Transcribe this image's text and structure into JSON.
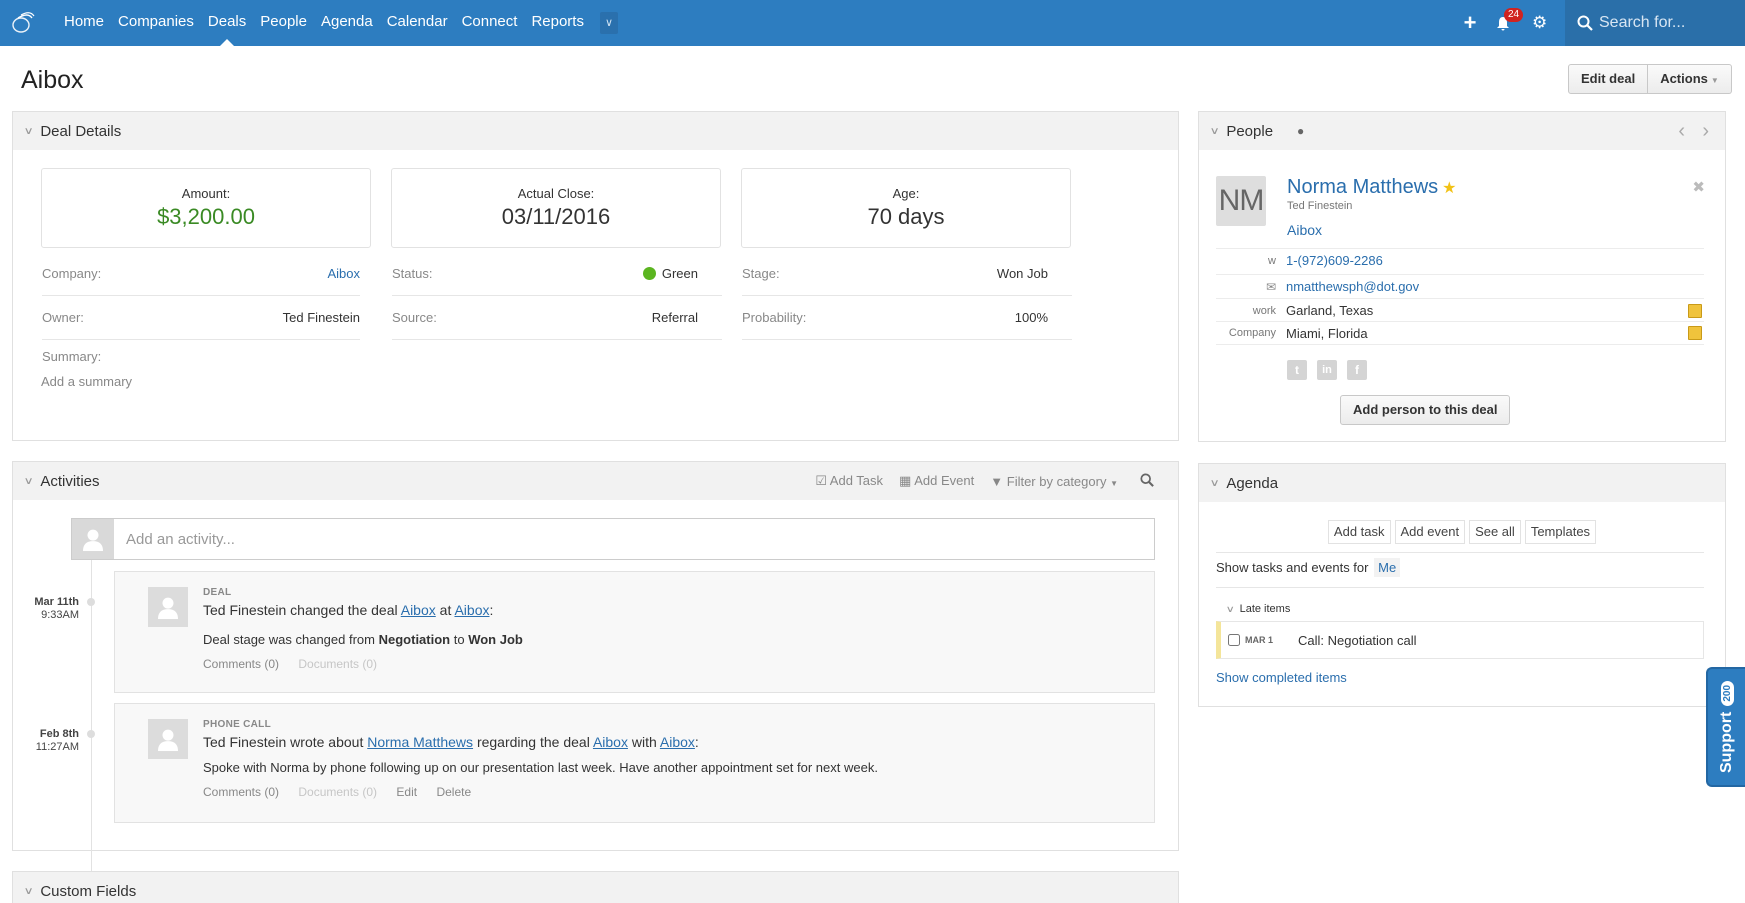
{
  "nav": {
    "items": [
      {
        "label": "Home",
        "active": false
      },
      {
        "label": "Companies",
        "active": false
      },
      {
        "label": "Deals",
        "active": true
      },
      {
        "label": "People",
        "active": false
      },
      {
        "label": "Agenda",
        "active": false
      },
      {
        "label": "Calendar",
        "active": false
      },
      {
        "label": "Connect",
        "active": false
      },
      {
        "label": "Reports",
        "active": false
      }
    ],
    "more_icon": "chevron-down-icon",
    "notifications_count": "24",
    "search_placeholder": "Search for..."
  },
  "page": {
    "title": "Aibox",
    "edit_label": "Edit deal",
    "actions_label": "Actions"
  },
  "deal_details": {
    "header": "Deal Details",
    "stats": [
      {
        "label": "Amount:",
        "value": "$3,200.00"
      },
      {
        "label": "Actual Close:",
        "value": "03/11/2016"
      },
      {
        "label": "Age:",
        "value": "70 days"
      }
    ],
    "fields": {
      "company": {
        "label": "Company:",
        "value": "Aibox"
      },
      "owner": {
        "label": "Owner:",
        "value": "Ted Finestein"
      },
      "status": {
        "label": "Status:",
        "value": "Green",
        "color": "#5bb520"
      },
      "source": {
        "label": "Source:",
        "value": "Referral"
      },
      "stage": {
        "label": "Stage:",
        "value": "Won Job"
      },
      "probability": {
        "label": "Probability:",
        "value": "100%"
      }
    },
    "summary_label": "Summary:",
    "summary_placeholder": "Add a summary"
  },
  "activities": {
    "header": "Activities",
    "add_task": "Add Task",
    "add_event": "Add Event",
    "filter": "Filter by category",
    "input_placeholder": "Add an activity...",
    "items": [
      {
        "date": "Mar 11th",
        "time": "9:33AM",
        "type": "DEAL",
        "author": "Ted Finestein",
        "verb": "changed the deal",
        "link1": "Aibox",
        "joiner": "at",
        "link2": "Aibox",
        "text_prefix": "Deal stage was changed from",
        "from": "Negotiation",
        "to_word": "to",
        "to": "Won Job",
        "comments": "Comments (0)",
        "documents": "Documents (0)"
      },
      {
        "date": "Feb 8th",
        "time": "11:27AM",
        "type": "PHONE CALL",
        "author": "Ted Finestein",
        "verb": "wrote about",
        "person": "Norma Matthews",
        "regarding": "regarding the deal",
        "link1": "Aibox",
        "joiner": "with",
        "link2": "Aibox",
        "text": "Spoke with Norma by phone following up on our presentation last week. Have another appointment set for next week.",
        "comments": "Comments (0)",
        "documents": "Documents (0)",
        "edit": "Edit",
        "delete": "Delete"
      }
    ]
  },
  "custom_fields": {
    "header": "Custom Fields"
  },
  "people": {
    "header": "People",
    "initials": "NM",
    "name": "Norma Matthews",
    "owner": "Ted Finestein",
    "company": "Aibox",
    "phone_label": "w",
    "phone": "1-(972)609-2286",
    "email": "nmatthewsph@dot.gov",
    "addresses": [
      {
        "label": "work",
        "value": "Garland, Texas"
      },
      {
        "label": "Company",
        "value": "Miami, Florida"
      }
    ],
    "social": [
      "twitter",
      "linkedin",
      "facebook"
    ],
    "add_button": "Add person to this deal"
  },
  "agenda": {
    "header": "Agenda",
    "buttons": [
      "Add task",
      "Add event",
      "See all",
      "Templates"
    ],
    "show_for": "Show tasks and events for",
    "show_for_value": "Me",
    "late_label": "Late items",
    "late_items": [
      {
        "date": "MAR 1",
        "title": "Call: Negotiation call",
        "checked": false
      }
    ],
    "show_completed": "Show completed items"
  },
  "support": {
    "label": "Support",
    "count": "200"
  }
}
